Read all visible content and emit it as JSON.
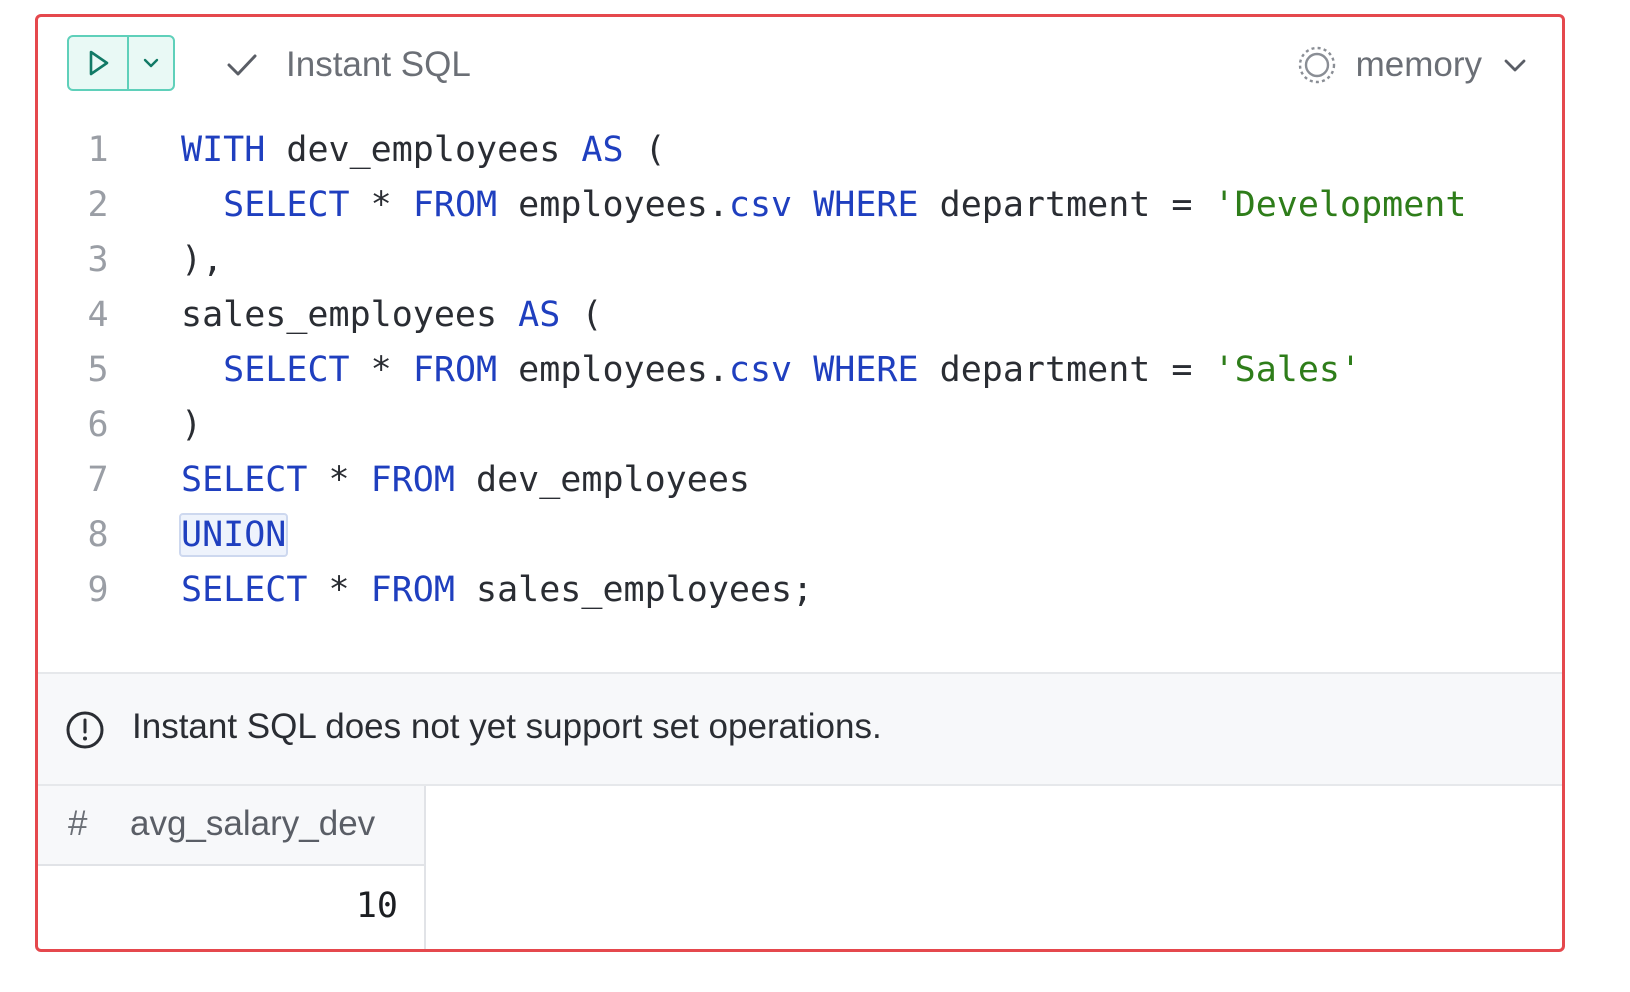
{
  "toolbar": {
    "instant_sql_label": "Instant SQL",
    "database_label": "memory"
  },
  "editor": {
    "lines": [
      {
        "number": "1",
        "tokens": [
          {
            "t": "WITH",
            "k": "kw"
          },
          {
            "t": " dev_employees ",
            "k": "id"
          },
          {
            "t": "AS",
            "k": "kw"
          },
          {
            "t": " (",
            "k": "punc"
          }
        ]
      },
      {
        "number": "2",
        "tokens": [
          {
            "t": "  ",
            "k": "id"
          },
          {
            "t": "SELECT",
            "k": "kw"
          },
          {
            "t": " * ",
            "k": "punc"
          },
          {
            "t": "FROM",
            "k": "kw"
          },
          {
            "t": " employees.",
            "k": "id"
          },
          {
            "t": "csv",
            "k": "kw"
          },
          {
            "t": " ",
            "k": "id"
          },
          {
            "t": "WHERE",
            "k": "kw"
          },
          {
            "t": " department = ",
            "k": "id"
          },
          {
            "t": "'Development",
            "k": "str"
          }
        ]
      },
      {
        "number": "3",
        "tokens": [
          {
            "t": "),",
            "k": "punc"
          }
        ]
      },
      {
        "number": "4",
        "tokens": [
          {
            "t": "sales_employees ",
            "k": "id"
          },
          {
            "t": "AS",
            "k": "kw"
          },
          {
            "t": " (",
            "k": "punc"
          }
        ]
      },
      {
        "number": "5",
        "tokens": [
          {
            "t": "  ",
            "k": "id"
          },
          {
            "t": "SELECT",
            "k": "kw"
          },
          {
            "t": " * ",
            "k": "punc"
          },
          {
            "t": "FROM",
            "k": "kw"
          },
          {
            "t": " employees.",
            "k": "id"
          },
          {
            "t": "csv",
            "k": "kw"
          },
          {
            "t": " ",
            "k": "id"
          },
          {
            "t": "WHERE",
            "k": "kw"
          },
          {
            "t": " department = ",
            "k": "id"
          },
          {
            "t": "'Sales'",
            "k": "str"
          }
        ]
      },
      {
        "number": "6",
        "tokens": [
          {
            "t": ")",
            "k": "punc"
          }
        ]
      },
      {
        "number": "7",
        "tokens": [
          {
            "t": "SELECT",
            "k": "kw"
          },
          {
            "t": " * ",
            "k": "punc"
          },
          {
            "t": "FROM",
            "k": "kw"
          },
          {
            "t": " dev_employees",
            "k": "id"
          }
        ]
      },
      {
        "number": "8",
        "tokens": [
          {
            "t": "UNION",
            "k": "kw",
            "highlight": true
          }
        ]
      },
      {
        "number": "9",
        "tokens": [
          {
            "t": "SELECT",
            "k": "kw"
          },
          {
            "t": " * ",
            "k": "punc"
          },
          {
            "t": "FROM",
            "k": "kw"
          },
          {
            "t": " sales_employees;",
            "k": "id"
          }
        ]
      }
    ]
  },
  "message": {
    "text": "Instant SQL does not yet support set operations.",
    "icon": "info-circle-icon"
  },
  "results": {
    "columns": [
      {
        "type_glyph": "#",
        "name": "avg_salary_dev"
      }
    ],
    "rows": [
      [
        "10"
      ]
    ]
  },
  "colors": {
    "frame_border": "#e5484d",
    "run_accent": "#5fd0ba",
    "keyword": "#1f3fbf",
    "string": "#2e7d1a"
  }
}
